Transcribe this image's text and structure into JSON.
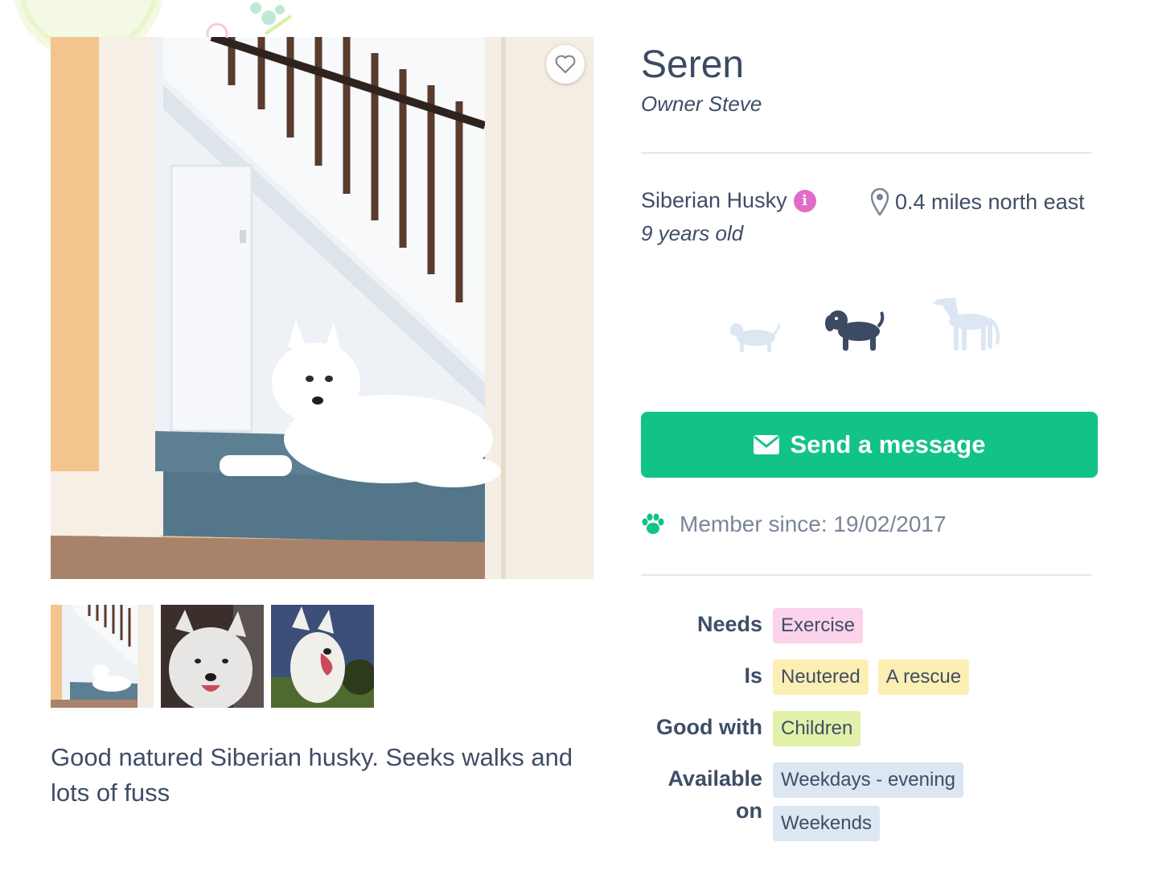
{
  "dog": {
    "name": "Seren",
    "owner": "Owner Steve",
    "breed": "Siberian Husky",
    "age": "9 years old",
    "distance": "0.4 miles north east",
    "description": "Good natured Siberian husky. Seeks walks and lots of fuss",
    "size_selected": "medium"
  },
  "actions": {
    "send_message": "Send a message"
  },
  "member": {
    "since": "Member since: 19/02/2017"
  },
  "traits": {
    "needs": {
      "label": "Needs",
      "tags": [
        "Exercise"
      ]
    },
    "is": {
      "label": "Is",
      "tags": [
        "Neutered",
        "A rescue"
      ]
    },
    "good_with": {
      "label": "Good with",
      "tags": [
        "Children"
      ]
    },
    "available_on": {
      "label": "Available on",
      "tags": [
        "Weekdays - evening",
        "Weekends"
      ]
    }
  },
  "colors": {
    "accent_green": "#12c387",
    "text_dark": "#3c4a63",
    "info_pink": "#e16cc7",
    "size_inactive": "#dde6f3",
    "size_active": "#3c4a63"
  },
  "icons": [
    "heart-icon",
    "info-icon",
    "location-pin-icon",
    "small-dog-icon",
    "medium-dog-icon",
    "large-dog-icon",
    "envelope-icon",
    "paw-icon"
  ]
}
